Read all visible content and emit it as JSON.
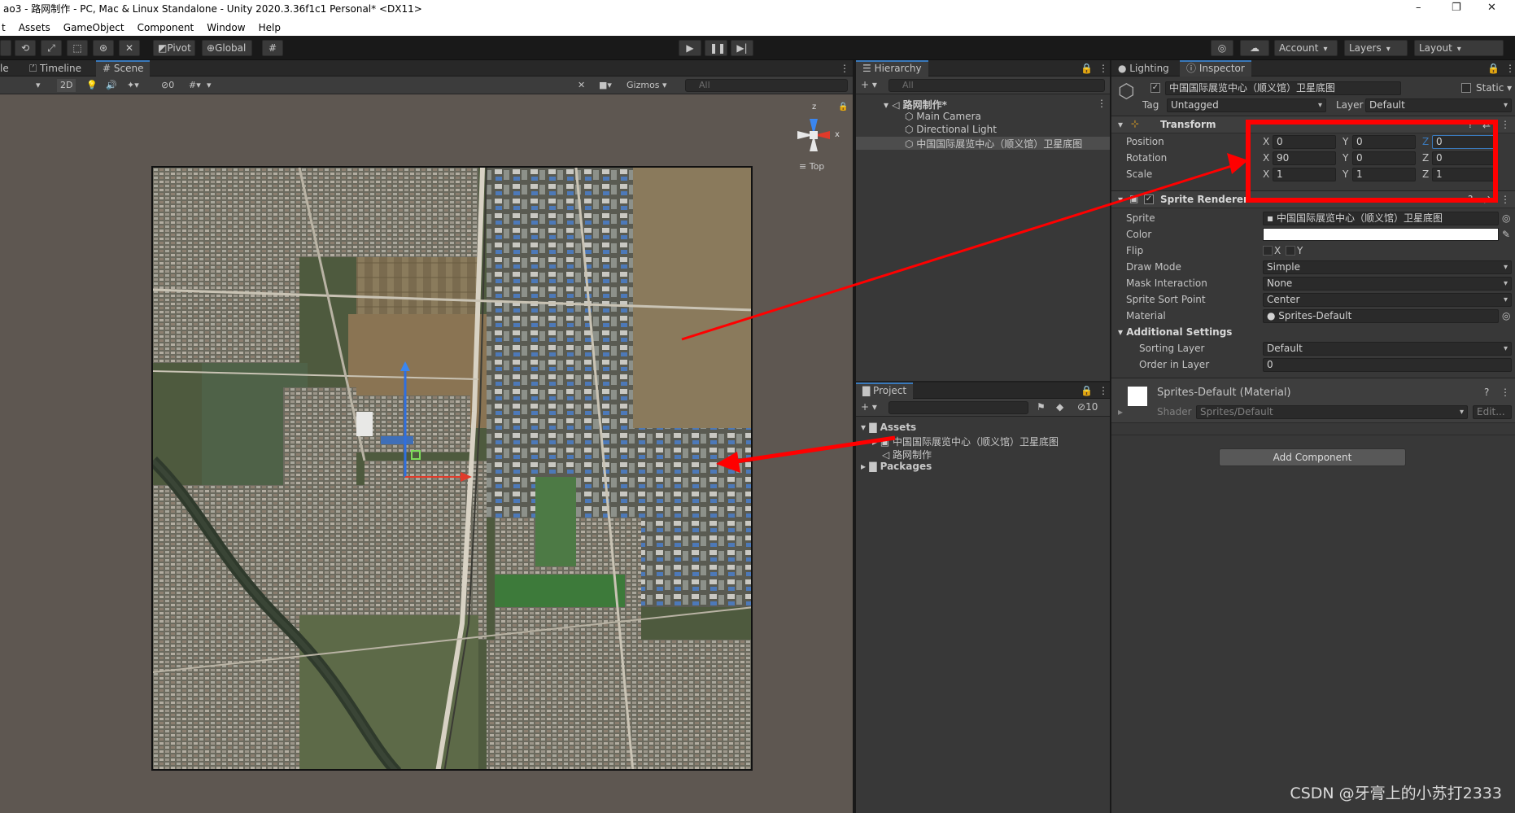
{
  "window": {
    "title": "ao3 - 路网制作 - PC, Mac & Linux Standalone - Unity 2020.3.36f1c1 Personal* <DX11>",
    "min": "–",
    "max": "❐",
    "close": "✕"
  },
  "menu": [
    "t",
    "Assets",
    "GameObject",
    "Component",
    "Window",
    "Help"
  ],
  "toolbar": {
    "pivot": "Pivot",
    "global": "Global",
    "account": "Account",
    "layers": "Layers",
    "layout": "Layout"
  },
  "scene_tabs": {
    "partial": "le",
    "timeline": "Timeline",
    "scene": "Scene"
  },
  "scene_bar": {
    "mode_2d": "2D",
    "hidden_count": "0",
    "gizmos": "Gizmos",
    "search_placeholder": "All"
  },
  "gizmo": {
    "z": "z",
    "x": "x",
    "view": "≡ Top"
  },
  "hierarchy": {
    "tab": "Hierarchy",
    "search_placeholder": "All",
    "scene": "路网制作*",
    "items": [
      "Main Camera",
      "Directional Light",
      "中国国际展览中心（顺义馆）卫星底图"
    ]
  },
  "project": {
    "tab": "Project",
    "hidden_count": "10",
    "assets": "Assets",
    "asset_items": [
      "中国国际展览中心（顺义馆）卫星底图",
      "路网制作"
    ],
    "packages": "Packages"
  },
  "inspector": {
    "tabs": {
      "lighting": "Lighting",
      "inspector": "Inspector"
    },
    "object_name": "中国国际展览中心（顺义馆）卫星底图",
    "static": "Static",
    "tag_label": "Tag",
    "tag": "Untagged",
    "layer_label": "Layer",
    "layer": "Default",
    "transform": {
      "title": "Transform",
      "position_label": "Position",
      "position": {
        "x": "0",
        "y": "0",
        "z": "0"
      },
      "rotation_label": "Rotation",
      "rotation": {
        "x": "90",
        "y": "0",
        "z": "0"
      },
      "scale_label": "Scale",
      "scale": {
        "x": "1",
        "y": "1",
        "z": "1"
      }
    },
    "sprite_renderer": {
      "title": "Sprite Renderer",
      "sprite_label": "Sprite",
      "sprite": "中国国际展览中心（顺义馆）卫星底图",
      "color_label": "Color",
      "color": "#ffffff",
      "flip_label": "Flip",
      "flip_x": "X",
      "flip_y": "Y",
      "draw_mode_label": "Draw Mode",
      "draw_mode": "Simple",
      "mask_label": "Mask Interaction",
      "mask": "None",
      "sort_point_label": "Sprite Sort Point",
      "sort_point": "Center",
      "material_label": "Material",
      "material": "Sprites-Default",
      "additional": "Additional Settings",
      "sorting_layer_label": "Sorting Layer",
      "sorting_layer": "Default",
      "order_label": "Order in Layer",
      "order": "0"
    },
    "material": {
      "title": "Sprites-Default (Material)",
      "shader_label": "Shader",
      "shader": "Sprites/Default",
      "edit": "Edit..."
    },
    "add_component": "Add Component"
  },
  "axes": {
    "x": "X",
    "y": "Y",
    "z": "Z"
  },
  "watermark": "CSDN @牙膏上的小苏打2333",
  "colors": {
    "accent": "#3a79bb",
    "annotation": "#ff0000"
  }
}
